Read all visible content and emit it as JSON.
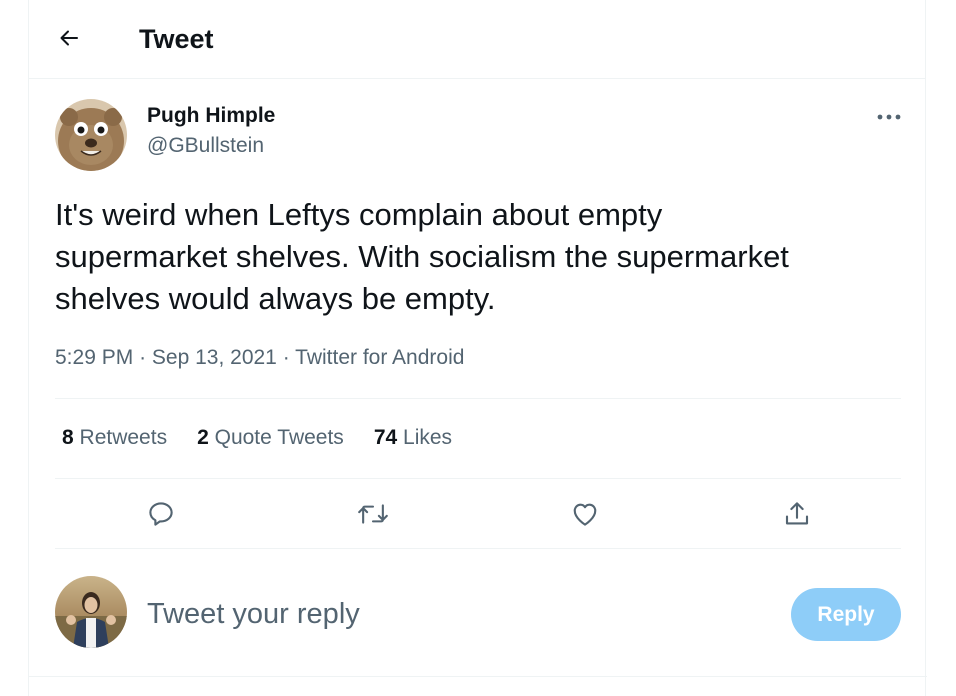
{
  "header": {
    "back_icon": "arrow-left-icon",
    "title": "Tweet"
  },
  "tweet": {
    "author_name": "Pugh Himple",
    "author_handle": "@GBullstein",
    "avatar": "bear-mascot-avatar",
    "more_icon": "more-horizontal-icon",
    "text": "It's weird when Leftys complain about empty\nsupermarket shelves. With socialism the supermarket\nshelves would always be empty.",
    "time": "5:29 PM",
    "date": "Sep 13, 2021",
    "source": "Twitter for Android",
    "separator": "·"
  },
  "stats": {
    "retweets_count": "8",
    "retweets_label": "Retweets",
    "quote_count": "2",
    "quote_label": "Quote Tweets",
    "likes_count": "74",
    "likes_label": "Likes"
  },
  "actions": {
    "reply_icon": "comment-icon",
    "retweet_icon": "retweet-icon",
    "like_icon": "heart-icon",
    "share_icon": "share-icon"
  },
  "reply": {
    "avatar": "user-photo-avatar",
    "placeholder": "Tweet your reply",
    "button_label": "Reply"
  },
  "colors": {
    "text_primary": "#0f1419",
    "text_secondary": "#536471",
    "divider": "#eff3f4",
    "reply_button_disabled": "#8ecdf8"
  }
}
